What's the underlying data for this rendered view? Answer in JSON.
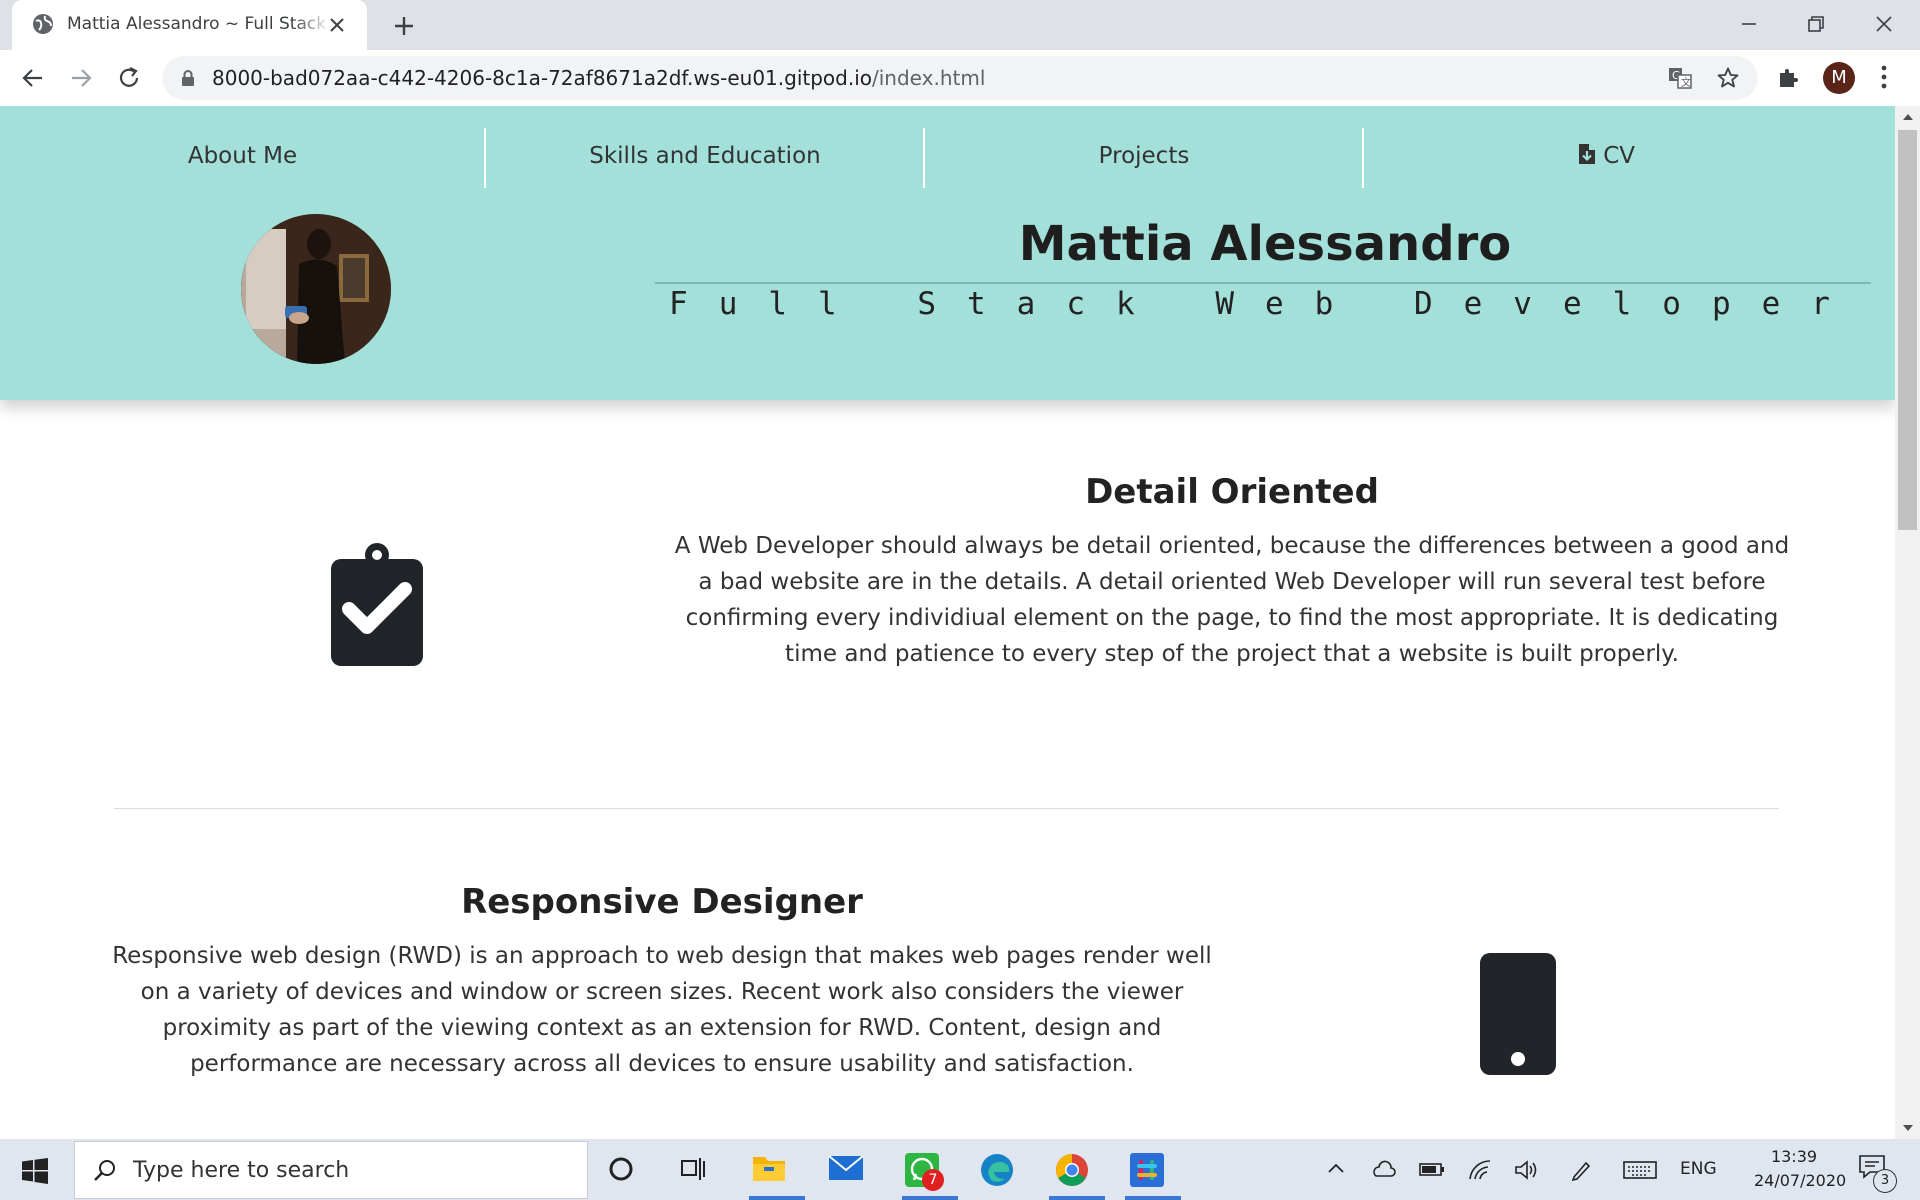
{
  "browser": {
    "tab_title": "Mattia Alessandro ~ Full Stack Web Developer",
    "url_host": "8000-bad072aa-c442-4206-8c1a-72af8671a2df.ws-eu01.gitpod.io",
    "url_path": "/index.html",
    "profile_initial": "M"
  },
  "nav": {
    "items": [
      {
        "label": "About Me"
      },
      {
        "label": "Skills and Education"
      },
      {
        "label": "Projects"
      },
      {
        "label": "CV",
        "icon": "file-download-icon"
      }
    ]
  },
  "header": {
    "name": "Mattia Alessandro",
    "role": "Full Stack Web Developer",
    "bg_color": "#a3e0da"
  },
  "sections": [
    {
      "title": "Detail Oriented",
      "icon": "clipboard-check-icon",
      "text": "A Web Developer should always be detail oriented, because the differences between a good and a bad website are in the details. A detail oriented Web Developer will run several test before confirming every individiual element on the page, to find the most appropriate. It is dedicating time and patience to every step of the project that a website is built properly."
    },
    {
      "title": "Responsive Designer",
      "icon": "mobile-phone-icon",
      "text": "Responsive web design (RWD) is an approach to web design that makes web pages render well on a variety of devices and window or screen sizes. Recent work also considers the viewer proximity as part of the viewing context as an extension for RWD. Content, design and performance are necessary across all devices to ensure usability and satisfaction."
    }
  ],
  "taskbar": {
    "search_placeholder": "Type here to search",
    "whatsapp_badge": "7",
    "language": "ENG",
    "time": "13:39",
    "date": "24/07/2020",
    "notification_count": "3"
  }
}
